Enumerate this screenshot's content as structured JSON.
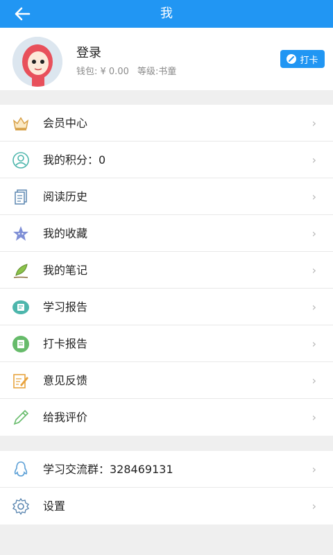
{
  "header": {
    "title": "我"
  },
  "profile": {
    "name": "登录",
    "wallet": "钱包: ¥ 0.00",
    "level": "等级:书童",
    "checkin_label": "打卡"
  },
  "menu": [
    {
      "label": "会员中心",
      "icon": "crown-icon"
    },
    {
      "label": "我的积分：0",
      "icon": "user-circle-icon"
    },
    {
      "label": "阅读历史",
      "icon": "history-docs-icon"
    },
    {
      "label": "我的收藏",
      "icon": "star-icon"
    },
    {
      "label": "我的笔记",
      "icon": "leaf-pen-icon"
    },
    {
      "label": "学习报告",
      "icon": "report-bubble-icon"
    },
    {
      "label": "打卡报告",
      "icon": "checkin-report-icon"
    },
    {
      "label": "意见反馈",
      "icon": "feedback-edit-icon"
    },
    {
      "label": "给我评价",
      "icon": "pencil-icon"
    }
  ],
  "menu2": [
    {
      "label": "学习交流群：328469131",
      "icon": "qq-penguin-icon"
    },
    {
      "label": "设置",
      "icon": "gear-icon"
    }
  ],
  "colors": {
    "accent": "#2196f3",
    "background": "#efefef"
  }
}
